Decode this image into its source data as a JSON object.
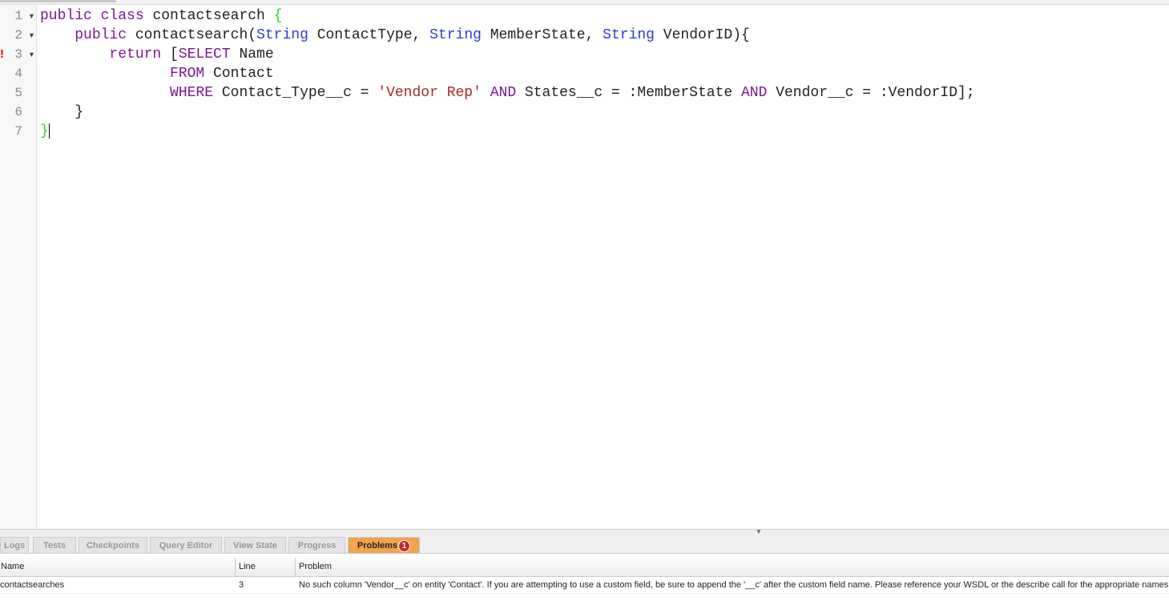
{
  "editor": {
    "line_numbers": [
      "1",
      "2",
      "3",
      "4",
      "5",
      "6",
      "7"
    ],
    "error_marker": "!",
    "lines": [
      [
        {
          "t": "kw",
          "v": "public class "
        },
        {
          "t": "",
          "v": "contactsearch "
        },
        {
          "t": "br",
          "v": "{"
        }
      ],
      [
        {
          "t": "",
          "v": "    "
        },
        {
          "t": "kw",
          "v": "public "
        },
        {
          "t": "",
          "v": "contactsearch("
        },
        {
          "t": "ty",
          "v": "String"
        },
        {
          "t": "",
          "v": " ContactType, "
        },
        {
          "t": "ty",
          "v": "String"
        },
        {
          "t": "",
          "v": " MemberState, "
        },
        {
          "t": "ty",
          "v": "String"
        },
        {
          "t": "",
          "v": " VendorID){"
        }
      ],
      [
        {
          "t": "",
          "v": "        "
        },
        {
          "t": "kw",
          "v": "return"
        },
        {
          "t": "",
          "v": " ["
        },
        {
          "t": "kw",
          "v": "SELECT"
        },
        {
          "t": "",
          "v": " Name"
        }
      ],
      [
        {
          "t": "",
          "v": "               "
        },
        {
          "t": "kw",
          "v": "FROM"
        },
        {
          "t": "",
          "v": " Contact"
        }
      ],
      [
        {
          "t": "",
          "v": "               "
        },
        {
          "t": "kw",
          "v": "WHERE"
        },
        {
          "t": "",
          "v": " Contact_Type__c = "
        },
        {
          "t": "st",
          "v": "'Vendor Rep'"
        },
        {
          "t": "",
          "v": " "
        },
        {
          "t": "kw",
          "v": "AND"
        },
        {
          "t": "",
          "v": " States__c = :MemberState "
        },
        {
          "t": "kw",
          "v": "AND"
        },
        {
          "t": "",
          "v": " Vendor__c = :VendorID];"
        }
      ],
      [
        {
          "t": "",
          "v": "    }"
        }
      ],
      [
        {
          "t": "br",
          "v": "}"
        }
      ]
    ]
  },
  "bottom_tabs": [
    "Logs",
    "Tests",
    "Checkpoints",
    "Query Editor",
    "View State",
    "Progress",
    "Problems"
  ],
  "problems_count": "1",
  "problems_table": {
    "headers": [
      "Name",
      "Line",
      "Problem"
    ],
    "rows": [
      {
        "name": "contactsearches",
        "line": "3",
        "problem": "No such column 'Vendor__c' on entity 'Contact'. If you are attempting to use a custom field, be sure to append the '__c' after the custom field name. Please reference your WSDL or the describe call for the appropriate names."
      }
    ]
  }
}
